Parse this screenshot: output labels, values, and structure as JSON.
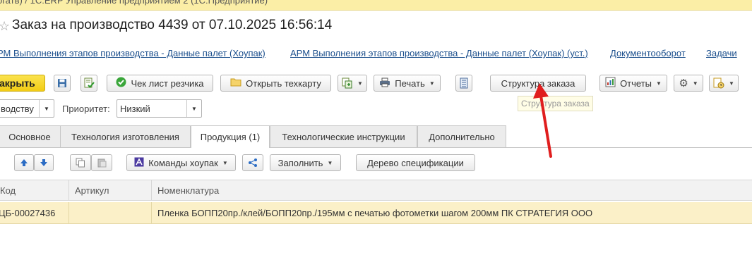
{
  "window": {
    "title_bar": "огатв) / 1С:ERP Управление предприятием 2 (1С:Предприятие)",
    "document_title": "Заказ на производство 4439 от 07.10.2025 16:56:14"
  },
  "links": [
    "РМ Выполнения этапов производства - Данные палет (Хоупак)",
    "АРМ Выполнения этапов производства - Данные палет (Хоупак) (уст.)",
    "Документооборот",
    "Задачи"
  ],
  "toolbar": {
    "close": "акрыть",
    "checklist": "Чек лист резчика",
    "open_techcard": "Открыть техкарту",
    "print": "Печать",
    "order_structure": "Структура заказа",
    "reports": "Отчеты",
    "tooltip": "Структура заказа"
  },
  "fields": {
    "direction_value": "водству",
    "priority_label": "Приоритет:",
    "priority_value": "Низкий"
  },
  "tabs": [
    "Основное",
    "Технология изготовления",
    "Продукция (1)",
    "Технологические инструкции",
    "Дополнительно"
  ],
  "active_tab": "Продукция (1)",
  "subtoolbar": {
    "hoopak_commands": "Команды хоупак",
    "fill": "Заполнить",
    "spec_tree": "Дерево спецификации"
  },
  "table": {
    "columns": [
      "Код",
      "Артикул",
      "Номенклатура"
    ],
    "rows": [
      {
        "code": "ЦБ-00027436",
        "article": "",
        "nomenclature": "Пленка БОПП20пр./клей/БОПП20пр./195мм с печатью фотометки шагом 200мм ПК СТРАТЕГИЯ ООО"
      }
    ]
  },
  "colors": {
    "close_button": "#f2cc14",
    "title_bar": "#fbeea6",
    "selected_row": "#fbf0c8",
    "link": "#1a4e8c",
    "annotation_arrow": "#e01e1e"
  }
}
